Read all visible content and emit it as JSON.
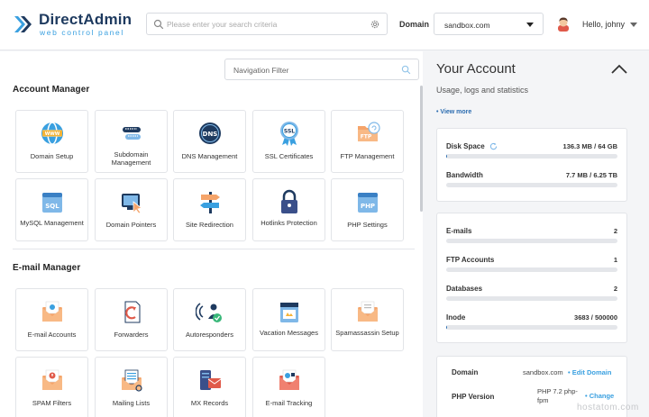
{
  "header": {
    "logo_title": "DirectAdmin",
    "logo_subtitle": "web control panel",
    "search_placeholder": "Please enter your search criteria",
    "domain_label": "Domain",
    "domain_selected": "sandbox.com",
    "greeting": "Hello,",
    "username": "johny"
  },
  "left": {
    "nav_filter_placeholder": "Navigation Filter",
    "sections": [
      {
        "title": "Account Manager",
        "tiles": [
          {
            "label": "Domain Setup",
            "icon": "globe-icon"
          },
          {
            "label": "Subdomain Management",
            "icon": "subdomain-icon"
          },
          {
            "label": "DNS Management",
            "icon": "dns-icon"
          },
          {
            "label": "SSL Certificates",
            "icon": "ssl-certificate-icon"
          },
          {
            "label": "FTP Management",
            "icon": "ftp-folder-icon"
          },
          {
            "label": "MySQL Management",
            "icon": "sql-icon"
          },
          {
            "label": "Domain Pointers",
            "icon": "domain-pointer-icon"
          },
          {
            "label": "Site Redirection",
            "icon": "signpost-icon"
          },
          {
            "label": "Hotlinks Protection",
            "icon": "padlock-icon"
          },
          {
            "label": "PHP Settings",
            "icon": "php-icon"
          }
        ]
      },
      {
        "title": "E-mail Manager",
        "tiles": [
          {
            "label": "E-mail Accounts",
            "icon": "email-envelope-icon"
          },
          {
            "label": "Forwarders",
            "icon": "forward-mail-icon"
          },
          {
            "label": "Autoresponders",
            "icon": "autoresponder-icon"
          },
          {
            "label": "Vacation Messages",
            "icon": "vacation-message-icon"
          },
          {
            "label": "Spamassassin Setup",
            "icon": "spamassassin-icon"
          },
          {
            "label": "SPAM Filters",
            "icon": "spam-filter-icon"
          },
          {
            "label": "Mailing Lists",
            "icon": "mailing-list-icon"
          },
          {
            "label": "MX Records",
            "icon": "mx-record-icon"
          },
          {
            "label": "E-mail Tracking",
            "icon": "email-tracking-icon"
          }
        ]
      }
    ]
  },
  "right": {
    "title": "Your Account",
    "subtitle": "Usage, logs and statistics",
    "view_more": "• View more",
    "usage": [
      {
        "name": "Disk Space",
        "value": "136.3 MB / 64 GB",
        "fraction": 0.002
      },
      {
        "name": "Bandwidth",
        "value": "7.7 MB / 6.25 TB",
        "fraction": 0.0
      },
      {
        "name": "E-mails",
        "value": "2",
        "fraction": 0.0
      },
      {
        "name": "FTP Accounts",
        "value": "1",
        "fraction": 0.0
      },
      {
        "name": "Databases",
        "value": "2",
        "fraction": 0.0
      },
      {
        "name": "Inode",
        "value": "3683 / 500000",
        "fraction": 0.007
      }
    ],
    "info": {
      "domain_label": "Domain",
      "domain_value": "sandbox.com",
      "domain_link": "• Edit Domain",
      "php_label": "PHP Version",
      "php_value_line1": "PHP 7.2 php-",
      "php_value_line2": "fpm",
      "php_link": "• Change"
    }
  },
  "watermark": "hostatom.com",
  "colors": {
    "accent": "#2b6cb0",
    "link": "#3aa0e0",
    "brand_dark": "#1e3a5f"
  }
}
